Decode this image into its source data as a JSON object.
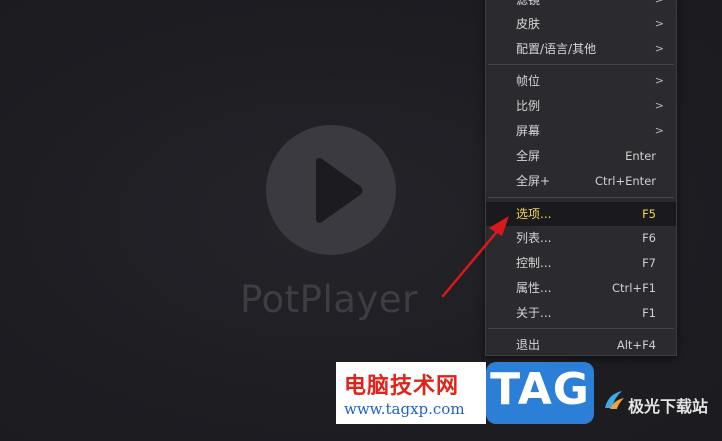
{
  "player": {
    "brand": "PotPlayer"
  },
  "menu": {
    "items": [
      {
        "label": "滤镜",
        "shortcut": "",
        "submenu": true
      },
      {
        "label": "皮肤",
        "shortcut": "",
        "submenu": true
      },
      {
        "label": "配置/语言/其他",
        "shortcut": "",
        "submenu": true
      },
      {
        "label": "帧位",
        "shortcut": "",
        "submenu": true
      },
      {
        "label": "比例",
        "shortcut": "",
        "submenu": true
      },
      {
        "label": "屏幕",
        "shortcut": "",
        "submenu": true
      },
      {
        "label": "全屏",
        "shortcut": "Enter",
        "submenu": false
      },
      {
        "label": "全屏+",
        "shortcut": "Ctrl+Enter",
        "submenu": false
      },
      {
        "label": "选项...",
        "shortcut": "F5",
        "submenu": false,
        "highlighted": true
      },
      {
        "label": "列表...",
        "shortcut": "F6",
        "submenu": false
      },
      {
        "label": "控制...",
        "shortcut": "F7",
        "submenu": false
      },
      {
        "label": "属性...",
        "shortcut": "Ctrl+F1",
        "submenu": false
      },
      {
        "label": "关于...",
        "shortcut": "F1",
        "submenu": false
      },
      {
        "label": "退出",
        "shortcut": "Alt+F4",
        "submenu": false
      }
    ],
    "submenu_arrow": ">"
  },
  "watermark": {
    "site_name": "电脑技术网",
    "site_url": "www.tagxp.com",
    "tag_logo": "TAG",
    "right_text": "极光下载站"
  },
  "colors": {
    "highlight_text": "#f2d45c",
    "annotation_arrow": "#d8191c",
    "tag_blue": "#2b7fd6"
  }
}
